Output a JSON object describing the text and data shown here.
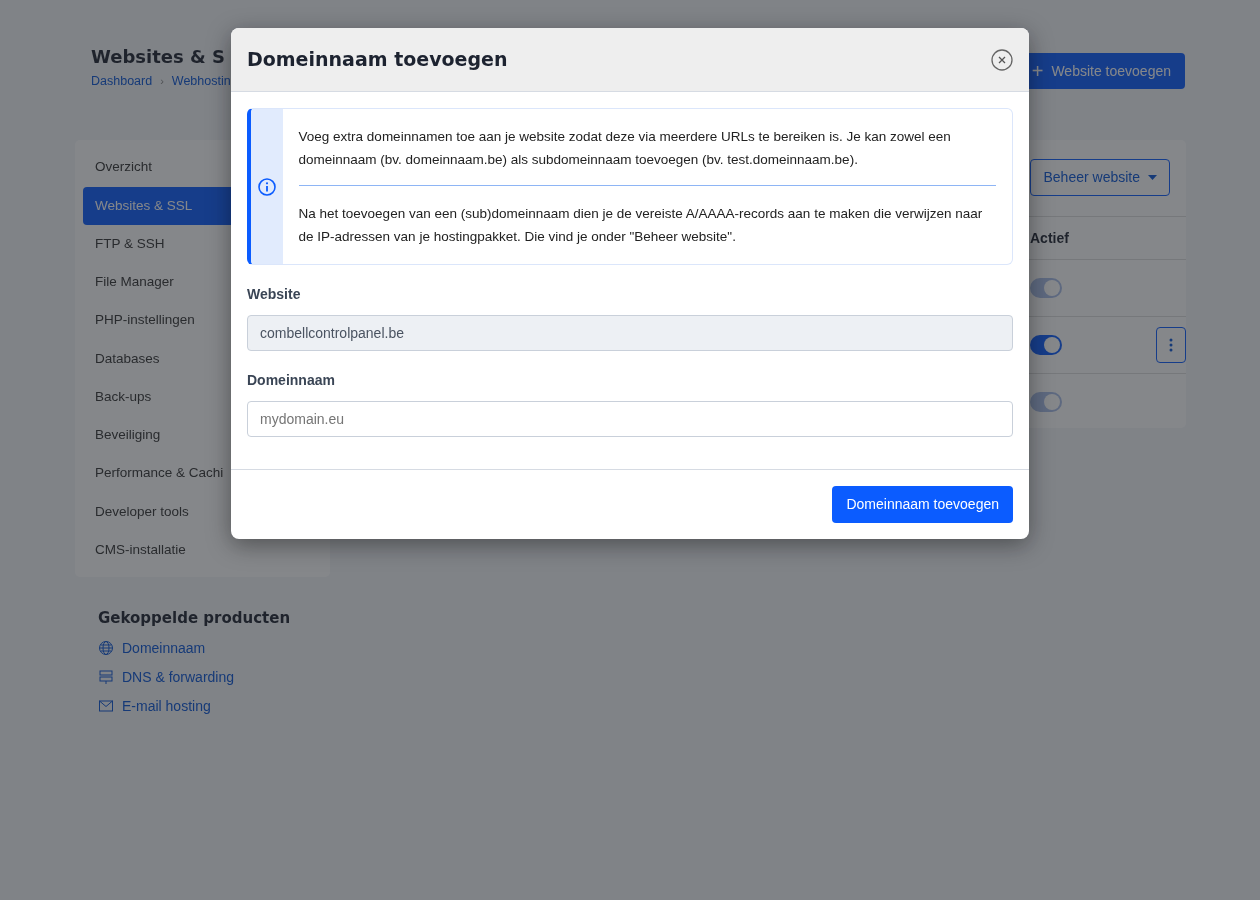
{
  "page": {
    "title": "Websites & S",
    "breadcrumb": [
      {
        "label": "Dashboard"
      },
      {
        "label": "Webhostin"
      }
    ],
    "breadcrumb_separator": "›",
    "add_button": {
      "icon": "+",
      "label": "Website toevoegen"
    }
  },
  "sidebar": {
    "items": [
      {
        "label": "Overzicht",
        "selected": false
      },
      {
        "label": "Websites & SSL",
        "selected": true
      },
      {
        "label": "FTP & SSH",
        "selected": false
      },
      {
        "label": "File Manager",
        "selected": false
      },
      {
        "label": "PHP-instellingen",
        "selected": false
      },
      {
        "label": "Databases",
        "selected": false
      },
      {
        "label": "Back-ups",
        "selected": false
      },
      {
        "label": "Beveiliging",
        "selected": false
      },
      {
        "label": "Performance & Cachi",
        "selected": false
      },
      {
        "label": "Developer tools",
        "selected": false
      },
      {
        "label": "CMS-installatie",
        "selected": false
      }
    ]
  },
  "linked_products": {
    "title": "Gekoppelde producten",
    "items": [
      {
        "kind": "globe",
        "label": "Domeinnaam"
      },
      {
        "kind": "signpost",
        "label": "DNS & forwarding"
      },
      {
        "kind": "mail",
        "label": "E-mail hosting"
      }
    ]
  },
  "main": {
    "manage_button": "Beheer website",
    "table": {
      "column_header": "Actief",
      "rows": [
        {
          "on": true,
          "disabled": true,
          "menu": false
        },
        {
          "on": true,
          "disabled": false,
          "menu": true
        },
        {
          "on": true,
          "disabled": true,
          "menu": false
        }
      ]
    }
  },
  "modal": {
    "title": "Domeinnaam toevoegen",
    "info": [
      "Voeg extra domeinnamen toe aan je website zodat deze via meerdere URLs te bereiken is. Je kan zowel een domeinnaam (bv. domeinnaam.be) als subdomeinnaam toevoegen (bv. test.domeinnaam.be).",
      "Na het toevoegen van een (sub)domeinnaam dien je de vereiste A/AAAA-records aan te maken die verwijzen naar de IP-adressen van je hostingpakket. Die vind je onder \"Beheer website\"."
    ],
    "fields": [
      {
        "label": "Website",
        "value": "combellcontrolpanel.be",
        "disabled": true
      },
      {
        "label": "Domeinnaam",
        "placeholder": "mydomain.eu",
        "disabled": false
      }
    ],
    "submit": "Domeinnaam toevoegen"
  }
}
